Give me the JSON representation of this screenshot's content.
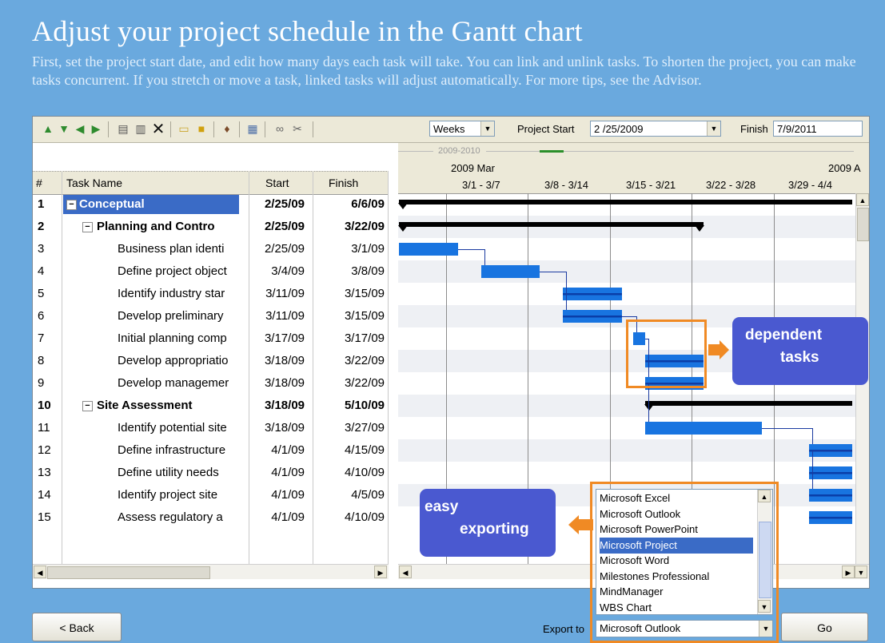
{
  "header": {
    "title": "Adjust your project schedule in the Gantt chart",
    "intro": "First, set the project start date, and edit how many days each task will take. You can link and unlink tasks. To shorten the project, you can make tasks concurrent. If you stretch or move a task, linked tasks will adjust automatically. For more tips, see the Advisor."
  },
  "toolbar": {
    "icons": [
      "move-up-icon",
      "move-down-icon",
      "outdent-icon",
      "indent-icon",
      "insert-task-icon",
      "insert-subtask-icon",
      "delete-icon",
      "insert-milestone-icon",
      "task-info-icon",
      "paint-icon",
      "calendar-icon",
      "link-icon",
      "unlink-icon"
    ],
    "timescale": "Weeks",
    "project_start_label": "Project Start",
    "project_start_value": "2 /25/2009",
    "finish_label": "Finish",
    "finish_value": "7/9/2011"
  },
  "grid": {
    "columns": [
      "#",
      "Task Name",
      "Start",
      "Finish"
    ],
    "rows": [
      {
        "num": "1",
        "name": "Conceptual",
        "start": "2/25/09",
        "finish": "6/6/09",
        "level": 0,
        "bold": true,
        "selected": true
      },
      {
        "num": "2",
        "name": "Planning and Contro",
        "start": "2/25/09",
        "finish": "3/22/09",
        "level": 1,
        "bold": true
      },
      {
        "num": "3",
        "name": "Business plan identi",
        "start": "2/25/09",
        "finish": "3/1/09",
        "level": 2
      },
      {
        "num": "4",
        "name": "Define project object",
        "start": "3/4/09",
        "finish": "3/8/09",
        "level": 2
      },
      {
        "num": "5",
        "name": "Identify industry star",
        "start": "3/11/09",
        "finish": "3/15/09",
        "level": 2
      },
      {
        "num": "6",
        "name": "Develop preliminary",
        "start": "3/11/09",
        "finish": "3/15/09",
        "level": 2
      },
      {
        "num": "7",
        "name": "Initial planning comp",
        "start": "3/17/09",
        "finish": "3/17/09",
        "level": 2
      },
      {
        "num": "8",
        "name": "Develop appropriatio",
        "start": "3/18/09",
        "finish": "3/22/09",
        "level": 2
      },
      {
        "num": "9",
        "name": "Develop managemer",
        "start": "3/18/09",
        "finish": "3/22/09",
        "level": 2
      },
      {
        "num": "10",
        "name": "Site Assessment",
        "start": "3/18/09",
        "finish": "5/10/09",
        "level": 1,
        "bold": true
      },
      {
        "num": "11",
        "name": "Identify potential site",
        "start": "3/18/09",
        "finish": "3/27/09",
        "level": 2
      },
      {
        "num": "12",
        "name": "Define infrastructure",
        "start": "4/1/09",
        "finish": "4/15/09",
        "level": 2
      },
      {
        "num": "13",
        "name": "Define utility needs",
        "start": "4/1/09",
        "finish": "4/10/09",
        "level": 2
      },
      {
        "num": "14",
        "name": "Identify project site",
        "start": "4/1/09",
        "finish": "4/5/09",
        "level": 2
      },
      {
        "num": "15",
        "name": "Assess regulatory a",
        "start": "4/1/09",
        "finish": "4/10/09",
        "level": 2
      }
    ]
  },
  "chart": {
    "period": "2009-2010",
    "month_left": "2009 Mar",
    "month_right": "2009 A",
    "weeks": [
      "3/1 - 3/7",
      "3/8 - 3/14",
      "3/15 - 3/21",
      "3/22 - 3/28",
      "3/29 - 4/4"
    ]
  },
  "callouts": {
    "dependent_line1": "dependent",
    "dependent_line2": "tasks",
    "export_line1": "easy",
    "export_line2": "exporting"
  },
  "export": {
    "label": "Export to",
    "selected": "Microsoft Outlook",
    "options": [
      "Microsoft Excel",
      "Microsoft Outlook",
      "Microsoft PowerPoint",
      "Microsoft Project",
      "Microsoft Word",
      "Milestones Professional",
      "MindManager",
      "WBS Chart"
    ],
    "highlighted_option": "Microsoft Project"
  },
  "buttons": {
    "back": "< Back",
    "go": "Go"
  },
  "colors": {
    "background": "#6aa9de",
    "task_bar": "#1874e0",
    "callout": "#4a59d0",
    "highlight_border": "#f08a24",
    "selection": "#3a6bc6"
  }
}
